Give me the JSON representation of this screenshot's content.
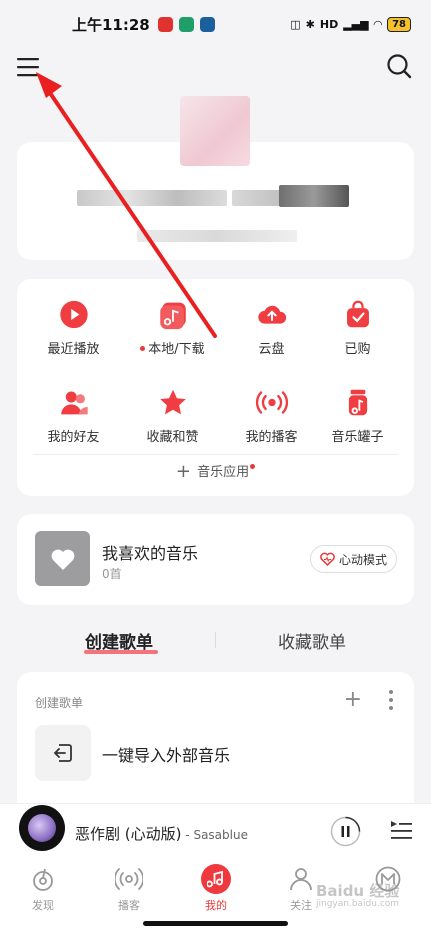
{
  "status_bar": {
    "time": "上午11:28",
    "network": "HD",
    "battery": "78"
  },
  "profile": {
    "name_redacted": true
  },
  "quick_grid": {
    "items": [
      {
        "label": "最近播放",
        "icon": "play-icon"
      },
      {
        "label": "本地/下载",
        "icon": "local-music-icon",
        "dot": true
      },
      {
        "label": "云盘",
        "icon": "cloud-upload-icon"
      },
      {
        "label": "已购",
        "icon": "shopping-bag-icon"
      },
      {
        "label": "我的好友",
        "icon": "friends-icon"
      },
      {
        "label": "收藏和赞",
        "icon": "star-icon"
      },
      {
        "label": "我的播客",
        "icon": "podcast-icon"
      },
      {
        "label": "音乐罐子",
        "icon": "music-jar-icon"
      }
    ],
    "music_apps_label": "音乐应用"
  },
  "favorites": {
    "title": "我喜欢的音乐",
    "count": "0首",
    "heart_mode_label": "心动模式"
  },
  "playlist_tabs": {
    "created": "创建歌单",
    "collected": "收藏歌单"
  },
  "created_section": {
    "header": "创建歌单",
    "import_label": "一键导入外部音乐"
  },
  "mini_player": {
    "song": "恶作剧 (心动版)",
    "separator": " - ",
    "artist": "Sasablue"
  },
  "bottom_nav": {
    "items": [
      {
        "label": "发现",
        "icon": "discover-icon"
      },
      {
        "label": "播客",
        "icon": "podcast-nav-icon"
      },
      {
        "label": "我的",
        "icon": "my-music-icon",
        "active": true
      },
      {
        "label": "关注",
        "icon": "follow-icon"
      },
      {
        "label": "",
        "icon": "message-icon"
      }
    ]
  },
  "watermark": {
    "brand": "Baidu 经验",
    "url": "jingyan.baidu.com"
  },
  "colors": {
    "accent": "#e8393b",
    "background": "#f4f3f6",
    "card": "#ffffff"
  }
}
